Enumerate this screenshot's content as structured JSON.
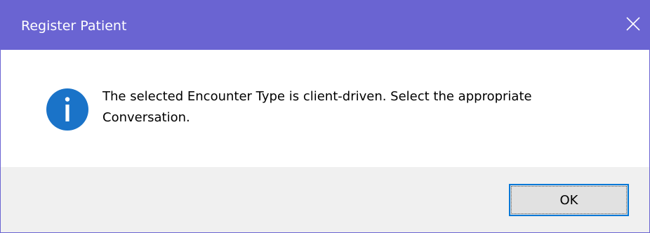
{
  "dialog": {
    "title": "Register Patient",
    "close_icon": "close-icon",
    "message": "The selected Encounter Type is client-driven.  Select the appropriate Conversation.",
    "info_icon": "info-icon",
    "ok_label": "OK"
  },
  "colors": {
    "titlebar": "#6a64d2",
    "info_icon": "#1a73c8",
    "button_focus": "#0078d7"
  }
}
